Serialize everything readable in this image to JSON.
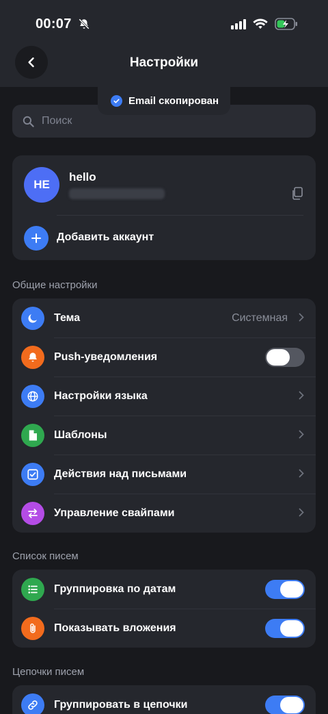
{
  "status_bar": {
    "time": "00:07"
  },
  "header": {
    "title": "Настройки"
  },
  "toast": {
    "text": "Email скопирован"
  },
  "search": {
    "placeholder": "Поиск"
  },
  "account": {
    "initials": "HE",
    "name": "hello",
    "add_label": "Добавить аккаунт"
  },
  "sections": {
    "general": {
      "title": "Общие настройки",
      "items": [
        {
          "label": "Тема",
          "value": "Системная"
        },
        {
          "label": "Push-уведомления",
          "toggle": "off"
        },
        {
          "label": "Настройки языка"
        },
        {
          "label": "Шаблоны"
        },
        {
          "label": "Действия над письмами"
        },
        {
          "label": "Управление свайпами"
        }
      ]
    },
    "list": {
      "title": "Список писем",
      "items": [
        {
          "label": "Группировка по датам",
          "toggle": "on"
        },
        {
          "label": "Показывать вложения",
          "toggle": "on"
        }
      ]
    },
    "threads": {
      "title": "Цепочки писем",
      "items": [
        {
          "label": "Группировать в цепочки",
          "toggle": "on"
        }
      ]
    }
  },
  "colors": {
    "background": "#18191d",
    "card": "#25272d",
    "accent_blue": "#3d7cf4",
    "icon_orange": "#f26b1d",
    "icon_green": "#2fa84f",
    "icon_purple": "#b44ce6",
    "avatar": "#4d6ef5"
  }
}
